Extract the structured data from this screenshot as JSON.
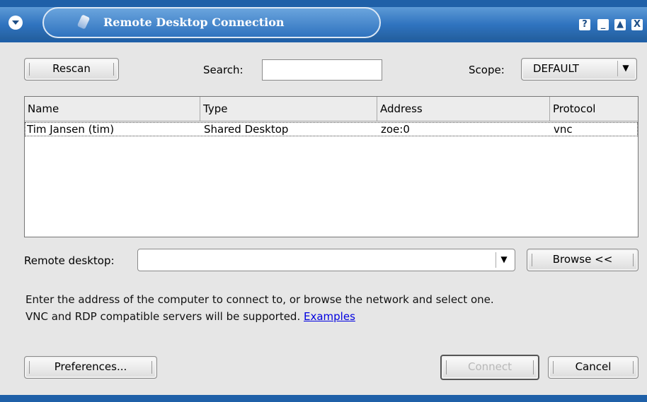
{
  "window": {
    "title": "Remote Desktop Connection",
    "controls": {
      "help": "?",
      "minimize": "_",
      "maximize": "▲",
      "close": "X"
    }
  },
  "toolbar": {
    "rescan_label": "Rescan",
    "search_label": "Search:",
    "search_value": "",
    "scope_label": "Scope:",
    "scope_value": "DEFAULT"
  },
  "list": {
    "columns": [
      "Name",
      "Type",
      "Address",
      "Protocol"
    ],
    "rows": [
      {
        "name": "Tim Jansen (tim)",
        "type": "Shared Desktop",
        "address": "zoe:0",
        "protocol": "vnc"
      }
    ]
  },
  "remote": {
    "label": "Remote desktop:",
    "value": "",
    "browse_label": "Browse <<"
  },
  "help": {
    "line1": "Enter the address of the computer to connect to, or browse the network and select one.",
    "line2": "VNC and RDP compatible servers will be supported.",
    "link": "Examples"
  },
  "footer": {
    "preferences_label": "Preferences...",
    "connect_label": "Connect",
    "cancel_label": "Cancel"
  },
  "colors": {
    "titlebar": "#2f73bf",
    "link": "#0000e0",
    "background": "#e6e6e6"
  },
  "icons": [
    "window-menu-icon",
    "remote-desktop-icon",
    "help-icon",
    "minimize-icon",
    "maximize-icon",
    "close-icon",
    "dropdown-arrow-icon"
  ]
}
